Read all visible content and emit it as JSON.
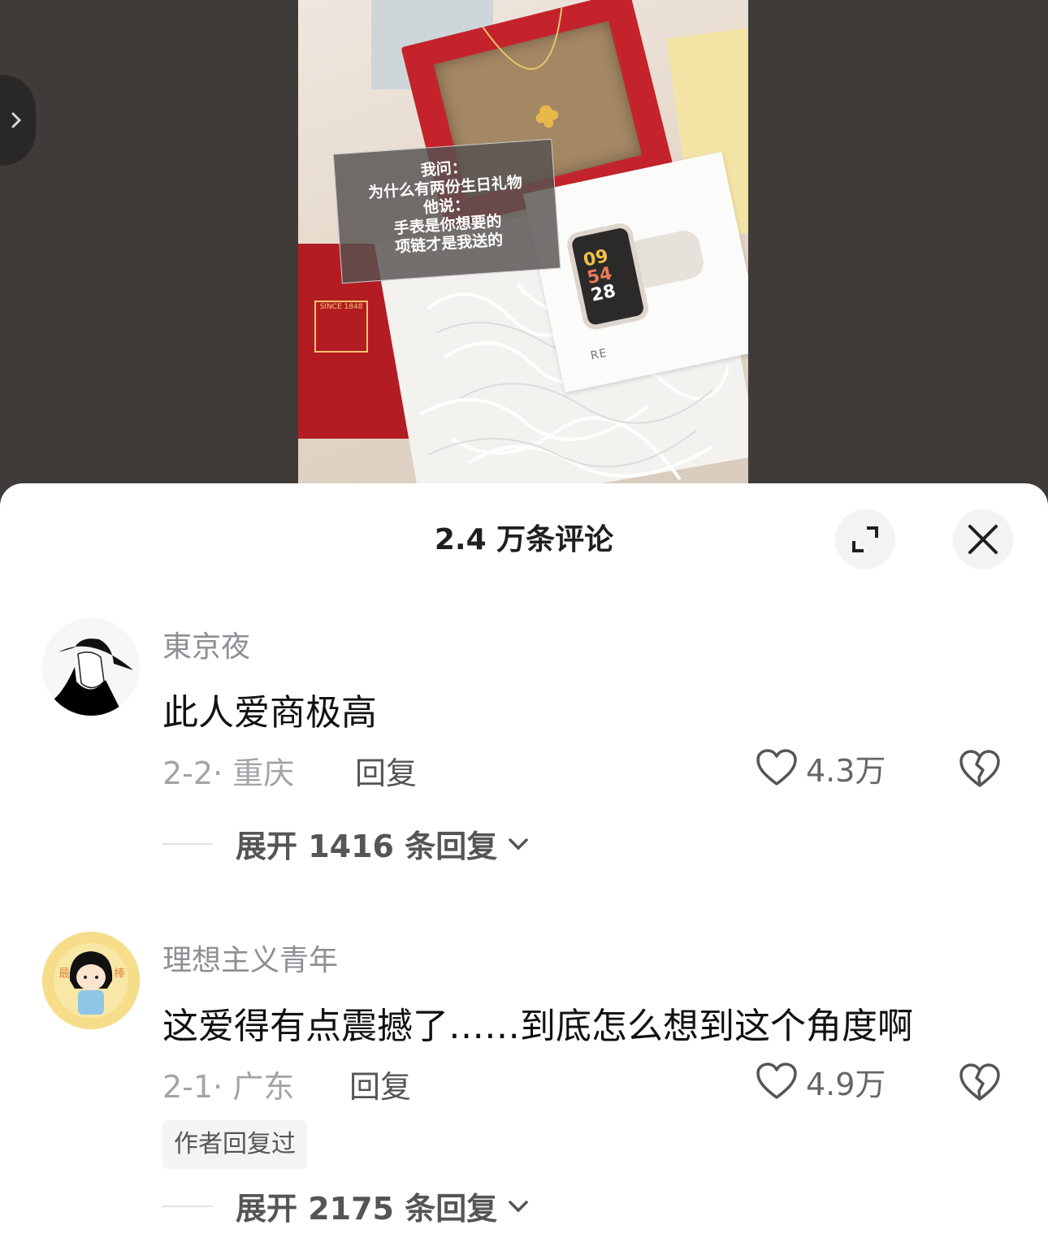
{
  "video": {
    "caption_lines": [
      "我问：",
      "为什么有两份生日礼物",
      "他说：",
      "手表是你想要的",
      "项链才是我送的"
    ],
    "watch_time": [
      "09",
      "54",
      "28"
    ],
    "watch_brand": "RE",
    "stamp_text": "SINCE 1848"
  },
  "sheet": {
    "title": "2.4 万条评论"
  },
  "comments": [
    {
      "username": "東京夜",
      "text": "此人爱商极高",
      "meta": "2-2· 重庆",
      "reply_label": "回复",
      "likes": "4.3万",
      "expand_label": "展开 1416 条回复"
    },
    {
      "username": "理想主义青年",
      "text": "这爱得有点震撼了……到底怎么想到这个角度啊",
      "meta": "2-1· 广东",
      "reply_label": "回复",
      "likes": "4.9万",
      "author_badge": "作者回复过",
      "expand_label": "展开 2175 条回复"
    }
  ],
  "colors": {
    "sheet_bg": "#ffffff",
    "video_bg": "#3e3b38",
    "username": "#8e8e94",
    "meta": "#a3a3a8"
  },
  "icons": [
    "chevron-right-icon",
    "expand-icon",
    "close-icon",
    "heart-icon",
    "broken-heart-icon",
    "chevron-down-icon"
  ]
}
